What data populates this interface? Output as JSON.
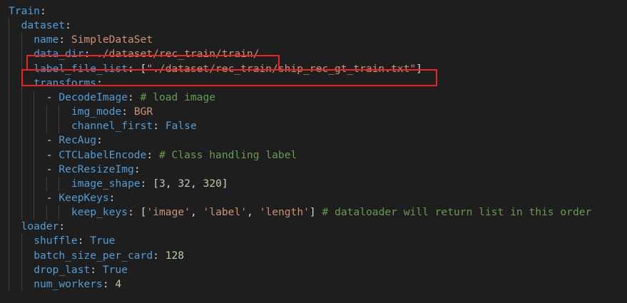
{
  "colors": {
    "background": "#1e1e1e",
    "key": "#569cd6",
    "string": "#ce9178",
    "number": "#b5cea8",
    "comment": "#6a9955",
    "plain": "#d4d4d4",
    "highlight_box": "#e8262a"
  },
  "lines": [
    {
      "indent": 0,
      "parts": [
        {
          "t": "Train",
          "c": "k"
        },
        {
          "t": ":",
          "c": "p"
        }
      ]
    },
    {
      "indent": 1,
      "parts": [
        {
          "t": "dataset",
          "c": "k"
        },
        {
          "t": ":",
          "c": "p"
        }
      ]
    },
    {
      "indent": 2,
      "parts": [
        {
          "t": "name",
          "c": "k"
        },
        {
          "t": ": ",
          "c": "p"
        },
        {
          "t": "SimpleDataSet",
          "c": "s"
        }
      ]
    },
    {
      "indent": 2,
      "parts": [
        {
          "t": "data_dir",
          "c": "k"
        },
        {
          "t": ": ",
          "c": "p"
        },
        {
          "t": "./dataset/rec_train/train/",
          "c": "s"
        }
      ]
    },
    {
      "indent": 2,
      "parts": [
        {
          "t": "label_file_list",
          "c": "k"
        },
        {
          "t": ": [",
          "c": "p"
        },
        {
          "t": "\"./dataset/rec_train/ship_rec_gt_train.txt\"",
          "c": "s"
        },
        {
          "t": "]",
          "c": "p"
        }
      ]
    },
    {
      "indent": 2,
      "parts": [
        {
          "t": "transforms",
          "c": "k"
        },
        {
          "t": ":",
          "c": "p"
        }
      ]
    },
    {
      "indent": 3,
      "parts": [
        {
          "t": "- ",
          "c": "p"
        },
        {
          "t": "DecodeImage",
          "c": "k"
        },
        {
          "t": ": ",
          "c": "p"
        },
        {
          "t": "# load image",
          "c": "c"
        }
      ]
    },
    {
      "indent": 5,
      "parts": [
        {
          "t": "img_mode",
          "c": "k"
        },
        {
          "t": ": ",
          "c": "p"
        },
        {
          "t": "BGR",
          "c": "s"
        }
      ]
    },
    {
      "indent": 5,
      "parts": [
        {
          "t": "channel_first",
          "c": "k"
        },
        {
          "t": ": ",
          "c": "p"
        },
        {
          "t": "False",
          "c": "k"
        }
      ]
    },
    {
      "indent": 3,
      "parts": [
        {
          "t": "- ",
          "c": "p"
        },
        {
          "t": "RecAug",
          "c": "k"
        },
        {
          "t": ":",
          "c": "p"
        }
      ]
    },
    {
      "indent": 3,
      "parts": [
        {
          "t": "- ",
          "c": "p"
        },
        {
          "t": "CTCLabelEncode",
          "c": "k"
        },
        {
          "t": ": ",
          "c": "p"
        },
        {
          "t": "# Class handling label",
          "c": "c"
        }
      ]
    },
    {
      "indent": 3,
      "parts": [
        {
          "t": "- ",
          "c": "p"
        },
        {
          "t": "RecResizeImg",
          "c": "k"
        },
        {
          "t": ":",
          "c": "p"
        }
      ]
    },
    {
      "indent": 5,
      "parts": [
        {
          "t": "image_shape",
          "c": "k"
        },
        {
          "t": ": [",
          "c": "p"
        },
        {
          "t": "3",
          "c": "n"
        },
        {
          "t": ", ",
          "c": "p"
        },
        {
          "t": "32",
          "c": "n"
        },
        {
          "t": ", ",
          "c": "p"
        },
        {
          "t": "320",
          "c": "n"
        },
        {
          "t": "]",
          "c": "p"
        }
      ]
    },
    {
      "indent": 3,
      "parts": [
        {
          "t": "- ",
          "c": "p"
        },
        {
          "t": "KeepKeys",
          "c": "k"
        },
        {
          "t": ":",
          "c": "p"
        }
      ]
    },
    {
      "indent": 5,
      "parts": [
        {
          "t": "keep_keys",
          "c": "k"
        },
        {
          "t": ": [",
          "c": "p"
        },
        {
          "t": "'image'",
          "c": "s"
        },
        {
          "t": ", ",
          "c": "p"
        },
        {
          "t": "'label'",
          "c": "s"
        },
        {
          "t": ", ",
          "c": "p"
        },
        {
          "t": "'length'",
          "c": "s"
        },
        {
          "t": "] ",
          "c": "p"
        },
        {
          "t": "# dataloader will return list in this order",
          "c": "c"
        }
      ]
    },
    {
      "indent": 1,
      "parts": [
        {
          "t": "loader",
          "c": "k"
        },
        {
          "t": ":",
          "c": "p"
        }
      ]
    },
    {
      "indent": 2,
      "parts": [
        {
          "t": "shuffle",
          "c": "k"
        },
        {
          "t": ": ",
          "c": "p"
        },
        {
          "t": "True",
          "c": "k"
        }
      ]
    },
    {
      "indent": 2,
      "parts": [
        {
          "t": "batch_size_per_card",
          "c": "k"
        },
        {
          "t": ": ",
          "c": "p"
        },
        {
          "t": "128",
          "c": "n"
        }
      ]
    },
    {
      "indent": 2,
      "parts": [
        {
          "t": "drop_last",
          "c": "k"
        },
        {
          "t": ": ",
          "c": "p"
        },
        {
          "t": "True",
          "c": "k"
        }
      ]
    },
    {
      "indent": 2,
      "parts": [
        {
          "t": "num_workers",
          "c": "k"
        },
        {
          "t": ": ",
          "c": "p"
        },
        {
          "t": "4",
          "c": "n"
        }
      ]
    }
  ]
}
